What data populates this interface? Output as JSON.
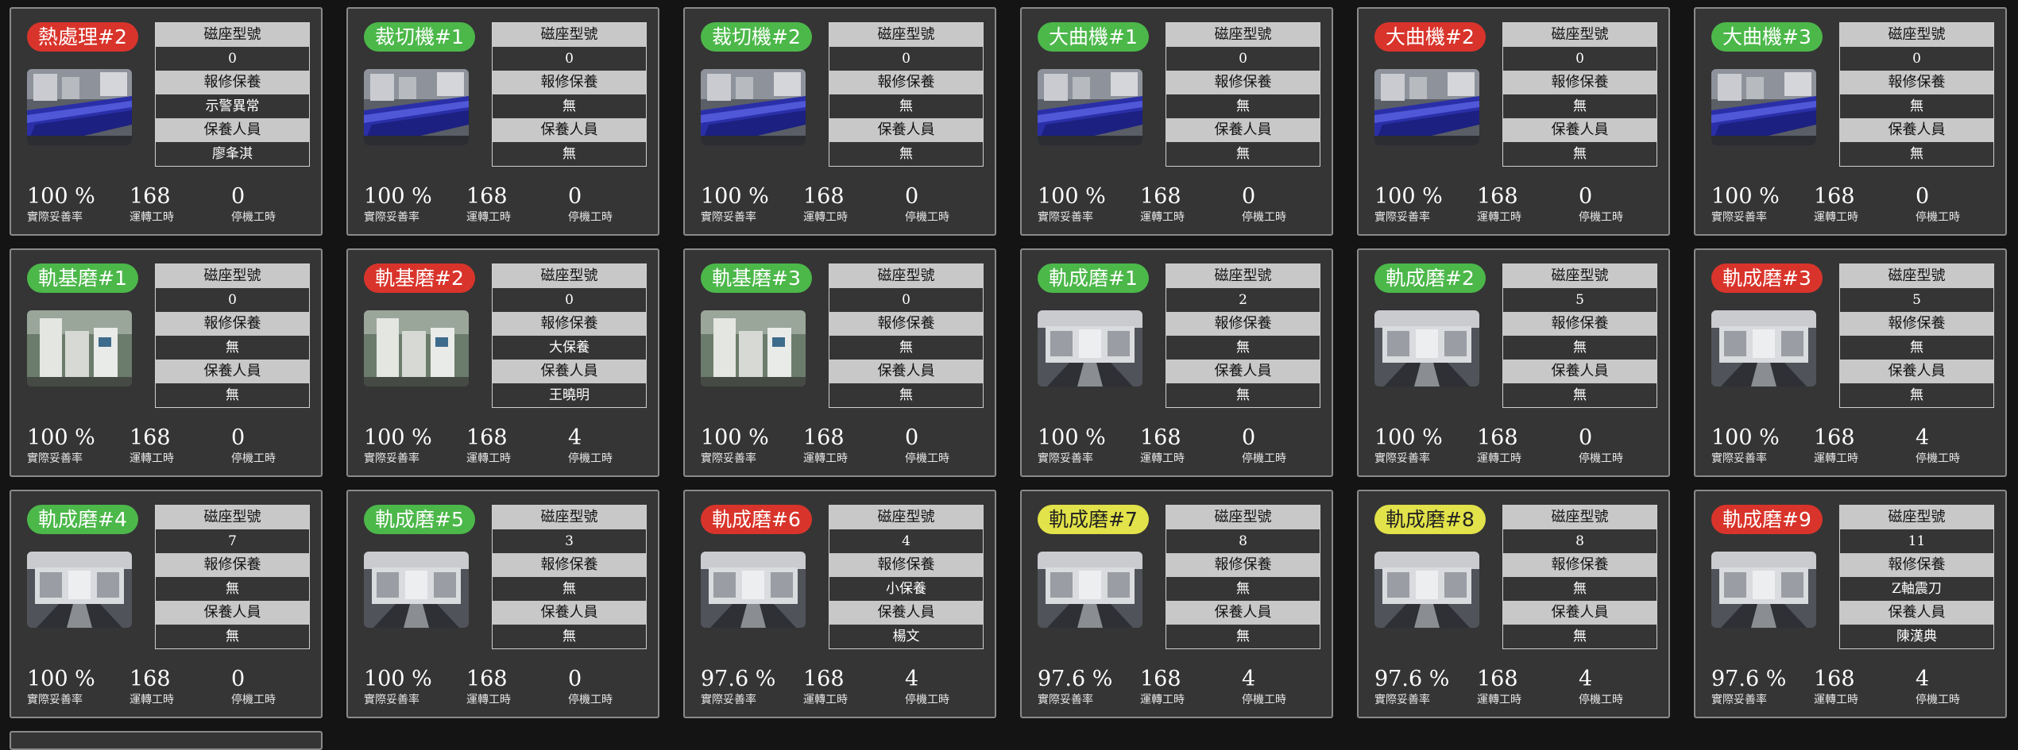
{
  "labels": {
    "model": "磁座型號",
    "repair": "報修保養",
    "staff": "保養人員",
    "rate": "實際妥善率",
    "run": "運轉工時",
    "stop": "停機工時"
  },
  "status_colors": {
    "green": "#4cb84a",
    "red": "#d9342b",
    "yellow": "#e2e24a"
  },
  "machines": [
    {
      "name": "熱處理#2",
      "status": "red",
      "photo": "blue-machine-icon",
      "model": "0",
      "repair": "示警異常",
      "staff": "廖夆淇",
      "rate": "100 %",
      "run": "168",
      "stop": "0"
    },
    {
      "name": "裁切機#1",
      "status": "green",
      "photo": "blue-machine-icon",
      "model": "0",
      "repair": "無",
      "staff": "無",
      "rate": "100 %",
      "run": "168",
      "stop": "0"
    },
    {
      "name": "裁切機#2",
      "status": "green",
      "photo": "blue-machine-icon",
      "model": "0",
      "repair": "無",
      "staff": "無",
      "rate": "100 %",
      "run": "168",
      "stop": "0"
    },
    {
      "name": "大曲機#1",
      "status": "green",
      "photo": "blue-machine-icon",
      "model": "0",
      "repair": "無",
      "staff": "無",
      "rate": "100 %",
      "run": "168",
      "stop": "0"
    },
    {
      "name": "大曲機#2",
      "status": "red",
      "photo": "blue-machine-icon",
      "model": "0",
      "repair": "無",
      "staff": "無",
      "rate": "100 %",
      "run": "168",
      "stop": "0"
    },
    {
      "name": "大曲機#3",
      "status": "green",
      "photo": "blue-machine-icon",
      "model": "0",
      "repair": "無",
      "staff": "無",
      "rate": "100 %",
      "run": "168",
      "stop": "0"
    },
    {
      "name": "軌基磨#1",
      "status": "green",
      "photo": "white-machine-icon",
      "model": "0",
      "repair": "無",
      "staff": "無",
      "rate": "100 %",
      "run": "168",
      "stop": "0"
    },
    {
      "name": "軌基磨#2",
      "status": "red",
      "photo": "white-machine-icon",
      "model": "0",
      "repair": "大保養",
      "staff": "王曉明",
      "rate": "100 %",
      "run": "168",
      "stop": "4"
    },
    {
      "name": "軌基磨#3",
      "status": "green",
      "photo": "white-machine-icon",
      "model": "0",
      "repair": "無",
      "staff": "無",
      "rate": "100 %",
      "run": "168",
      "stop": "0"
    },
    {
      "name": "軌成磨#1",
      "status": "green",
      "photo": "grinder-machine-icon",
      "model": "2",
      "repair": "無",
      "staff": "無",
      "rate": "100 %",
      "run": "168",
      "stop": "0"
    },
    {
      "name": "軌成磨#2",
      "status": "green",
      "photo": "grinder-machine-icon",
      "model": "5",
      "repair": "無",
      "staff": "無",
      "rate": "100 %",
      "run": "168",
      "stop": "0"
    },
    {
      "name": "軌成磨#3",
      "status": "red",
      "photo": "grinder-machine-icon",
      "model": "5",
      "repair": "無",
      "staff": "無",
      "rate": "100 %",
      "run": "168",
      "stop": "4"
    },
    {
      "name": "軌成磨#4",
      "status": "green",
      "photo": "grinder-machine-icon",
      "model": "7",
      "repair": "無",
      "staff": "無",
      "rate": "100 %",
      "run": "168",
      "stop": "0"
    },
    {
      "name": "軌成磨#5",
      "status": "green",
      "photo": "grinder-machine-icon",
      "model": "3",
      "repair": "無",
      "staff": "無",
      "rate": "100 %",
      "run": "168",
      "stop": "0"
    },
    {
      "name": "軌成磨#6",
      "status": "red",
      "photo": "grinder-machine-icon",
      "model": "4",
      "repair": "小保養",
      "staff": "楊文",
      "rate": "97.6 %",
      "run": "168",
      "stop": "4"
    },
    {
      "name": "軌成磨#7",
      "status": "yellow",
      "photo": "grinder-machine-icon",
      "model": "8",
      "repair": "無",
      "staff": "無",
      "rate": "97.6 %",
      "run": "168",
      "stop": "4"
    },
    {
      "name": "軌成磨#8",
      "status": "yellow",
      "photo": "grinder-machine-icon",
      "model": "8",
      "repair": "無",
      "staff": "無",
      "rate": "97.6 %",
      "run": "168",
      "stop": "4"
    },
    {
      "name": "軌成磨#9",
      "status": "red",
      "photo": "grinder-machine-icon",
      "model": "11",
      "repair": "Z軸震刀",
      "staff": "陳漢典",
      "rate": "97.6 %",
      "run": "168",
      "stop": "4"
    }
  ]
}
